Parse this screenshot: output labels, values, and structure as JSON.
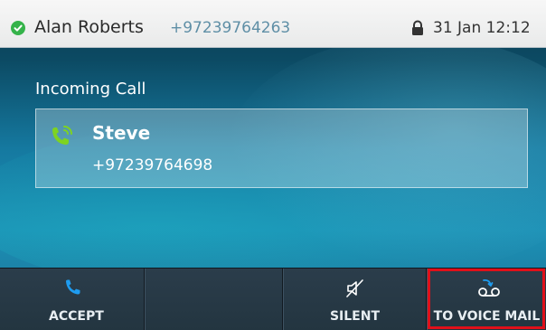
{
  "status_bar": {
    "user_name": "Alan Roberts",
    "user_number": "+97239764263",
    "datetime": "31 Jan 12:12",
    "presence_icon": "check-circle-icon",
    "lock_icon": "lock-icon",
    "presence_color": "#35b34a"
  },
  "call": {
    "header": "Incoming Call",
    "caller_name": "Steve",
    "caller_number": "+97239764698",
    "phone_icon": "incoming-call-icon",
    "phone_icon_color": "#7ed321"
  },
  "softkeys": [
    {
      "label": "ACCEPT",
      "icon": "phone-icon",
      "icon_color": "#1e9cf0"
    },
    {
      "label": "",
      "icon": "",
      "icon_color": ""
    },
    {
      "label": "SILENT",
      "icon": "speaker-mute-icon",
      "icon_color": "#ffffff"
    },
    {
      "label": "TO VOICE MAIL",
      "icon": "voicemail-icon",
      "icon_color": "#ffffff",
      "highlighted": true
    }
  ],
  "colors": {
    "highlight_border": "#e0101a",
    "softkey_bar": "#2b3d4b"
  }
}
